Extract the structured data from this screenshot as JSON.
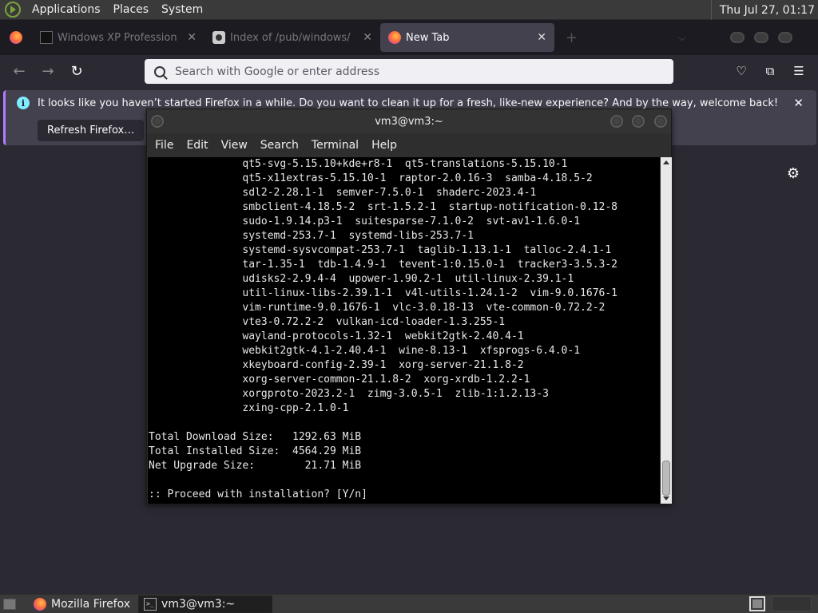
{
  "top_panel": {
    "menus": [
      "Applications",
      "Places",
      "System"
    ],
    "clock": "Thu Jul 27, 01:17"
  },
  "tabs": [
    {
      "title": "Windows XP Professional",
      "active": false
    },
    {
      "title": "Index of /pub/windows/",
      "active": false
    },
    {
      "title": "New Tab",
      "active": true
    }
  ],
  "navbar": {
    "url_placeholder": "Search with Google or enter address"
  },
  "notification": {
    "message": "It looks like you haven’t started Firefox in a while. Do you want to clean it up for a fresh, like-new experience? And by the way, welcome back!",
    "button": "Refresh Firefox…"
  },
  "terminal": {
    "title": "vm3@vm3:~",
    "menu": [
      "File",
      "Edit",
      "View",
      "Search",
      "Terminal",
      "Help"
    ],
    "lines": [
      "               qt5-svg-5.15.10+kde+r8-1  qt5-translations-5.15.10-1",
      "               qt5-x11extras-5.15.10-1  raptor-2.0.16-3  samba-4.18.5-2",
      "               sdl2-2.28.1-1  semver-7.5.0-1  shaderc-2023.4-1",
      "               smbclient-4.18.5-2  srt-1.5.2-1  startup-notification-0.12-8",
      "               sudo-1.9.14.p3-1  suitesparse-7.1.0-2  svt-av1-1.6.0-1",
      "               systemd-253.7-1  systemd-libs-253.7-1",
      "               systemd-sysvcompat-253.7-1  taglib-1.13.1-1  talloc-2.4.1-1",
      "               tar-1.35-1  tdb-1.4.9-1  tevent-1:0.15.0-1  tracker3-3.5.3-2",
      "               udisks2-2.9.4-4  upower-1.90.2-1  util-linux-2.39.1-1",
      "               util-linux-libs-2.39.1-1  v4l-utils-1.24.1-2  vim-9.0.1676-1",
      "               vim-runtime-9.0.1676-1  vlc-3.0.18-13  vte-common-0.72.2-2",
      "               vte3-0.72.2-2  vulkan-icd-loader-1.3.255-1",
      "               wayland-protocols-1.32-1  webkit2gtk-2.40.4-1",
      "               webkit2gtk-4.1-2.40.4-1  wine-8.13-1  xfsprogs-6.4.0-1",
      "               xkeyboard-config-2.39-1  xorg-server-21.1.8-2",
      "               xorg-server-common-21.1.8-2  xorg-xrdb-1.2.2-1",
      "               xorgproto-2023.2-1  zimg-3.0.5-1  zlib-1:1.2.13-3",
      "               zxing-cpp-2.1.0-1",
      "",
      "Total Download Size:   1292.63 MiB",
      "Total Installed Size:  4564.29 MiB",
      "Net Upgrade Size:        21.71 MiB",
      "",
      ":: Proceed with installation? [Y/n] "
    ]
  },
  "taskbar": {
    "items": [
      {
        "label": "Mozilla Firefox",
        "active": false
      },
      {
        "label": "vm3@vm3:~",
        "active": true
      }
    ]
  }
}
